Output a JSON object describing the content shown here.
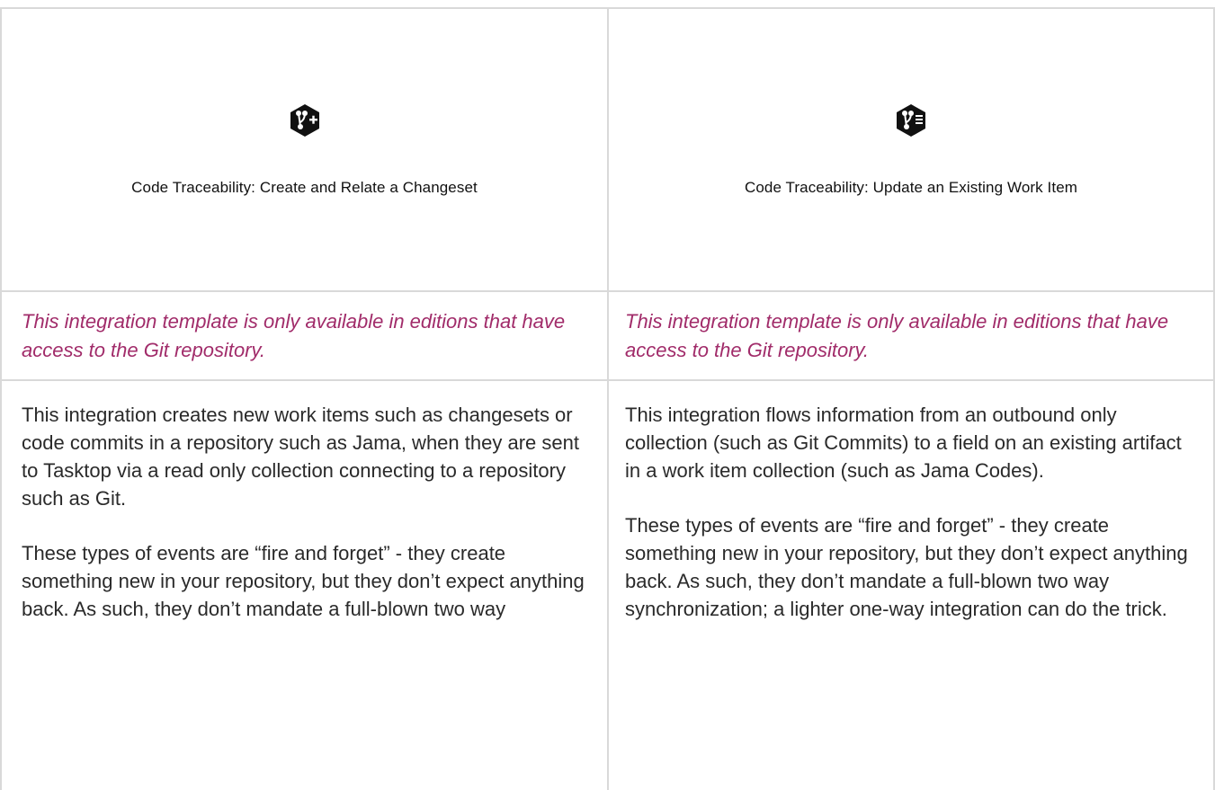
{
  "cards": [
    {
      "icon": "git-branch-plus-icon",
      "title": "Code Traceability: Create and Relate a Changeset",
      "note": "This integration template is only available in editions that have access to the Git repository.",
      "paragraphs": [
        "This integration creates new work items such as changesets or code commits in a repository such as Jama, when they are sent to Tasktop via a read only collection connecting to a repository such as Git.",
        "These types of events are “fire and forget” - they create something new in your repository, but they don’t expect anything back. As such, they don’t mandate a full-blown two way"
      ]
    },
    {
      "icon": "git-branch-list-icon",
      "title": "Code Traceability: Update an Existing Work Item",
      "note": "This integration template is only available in editions that have access to the Git repository.",
      "paragraphs": [
        "This integration flows information from an outbound only collection (such as Git Commits) to a field on an existing artifact in a work item collection (such as Jama Codes).",
        "These types of events are “fire and forget” - they create something new in your repository, but they don’t expect anything back. As such, they don’t mandate a full-blown two way synchronization; a lighter one-way integration can do the trick."
      ]
    }
  ],
  "colors": {
    "note": "#a12c6a",
    "border": "#d9d9d9",
    "icon": "#111111"
  }
}
